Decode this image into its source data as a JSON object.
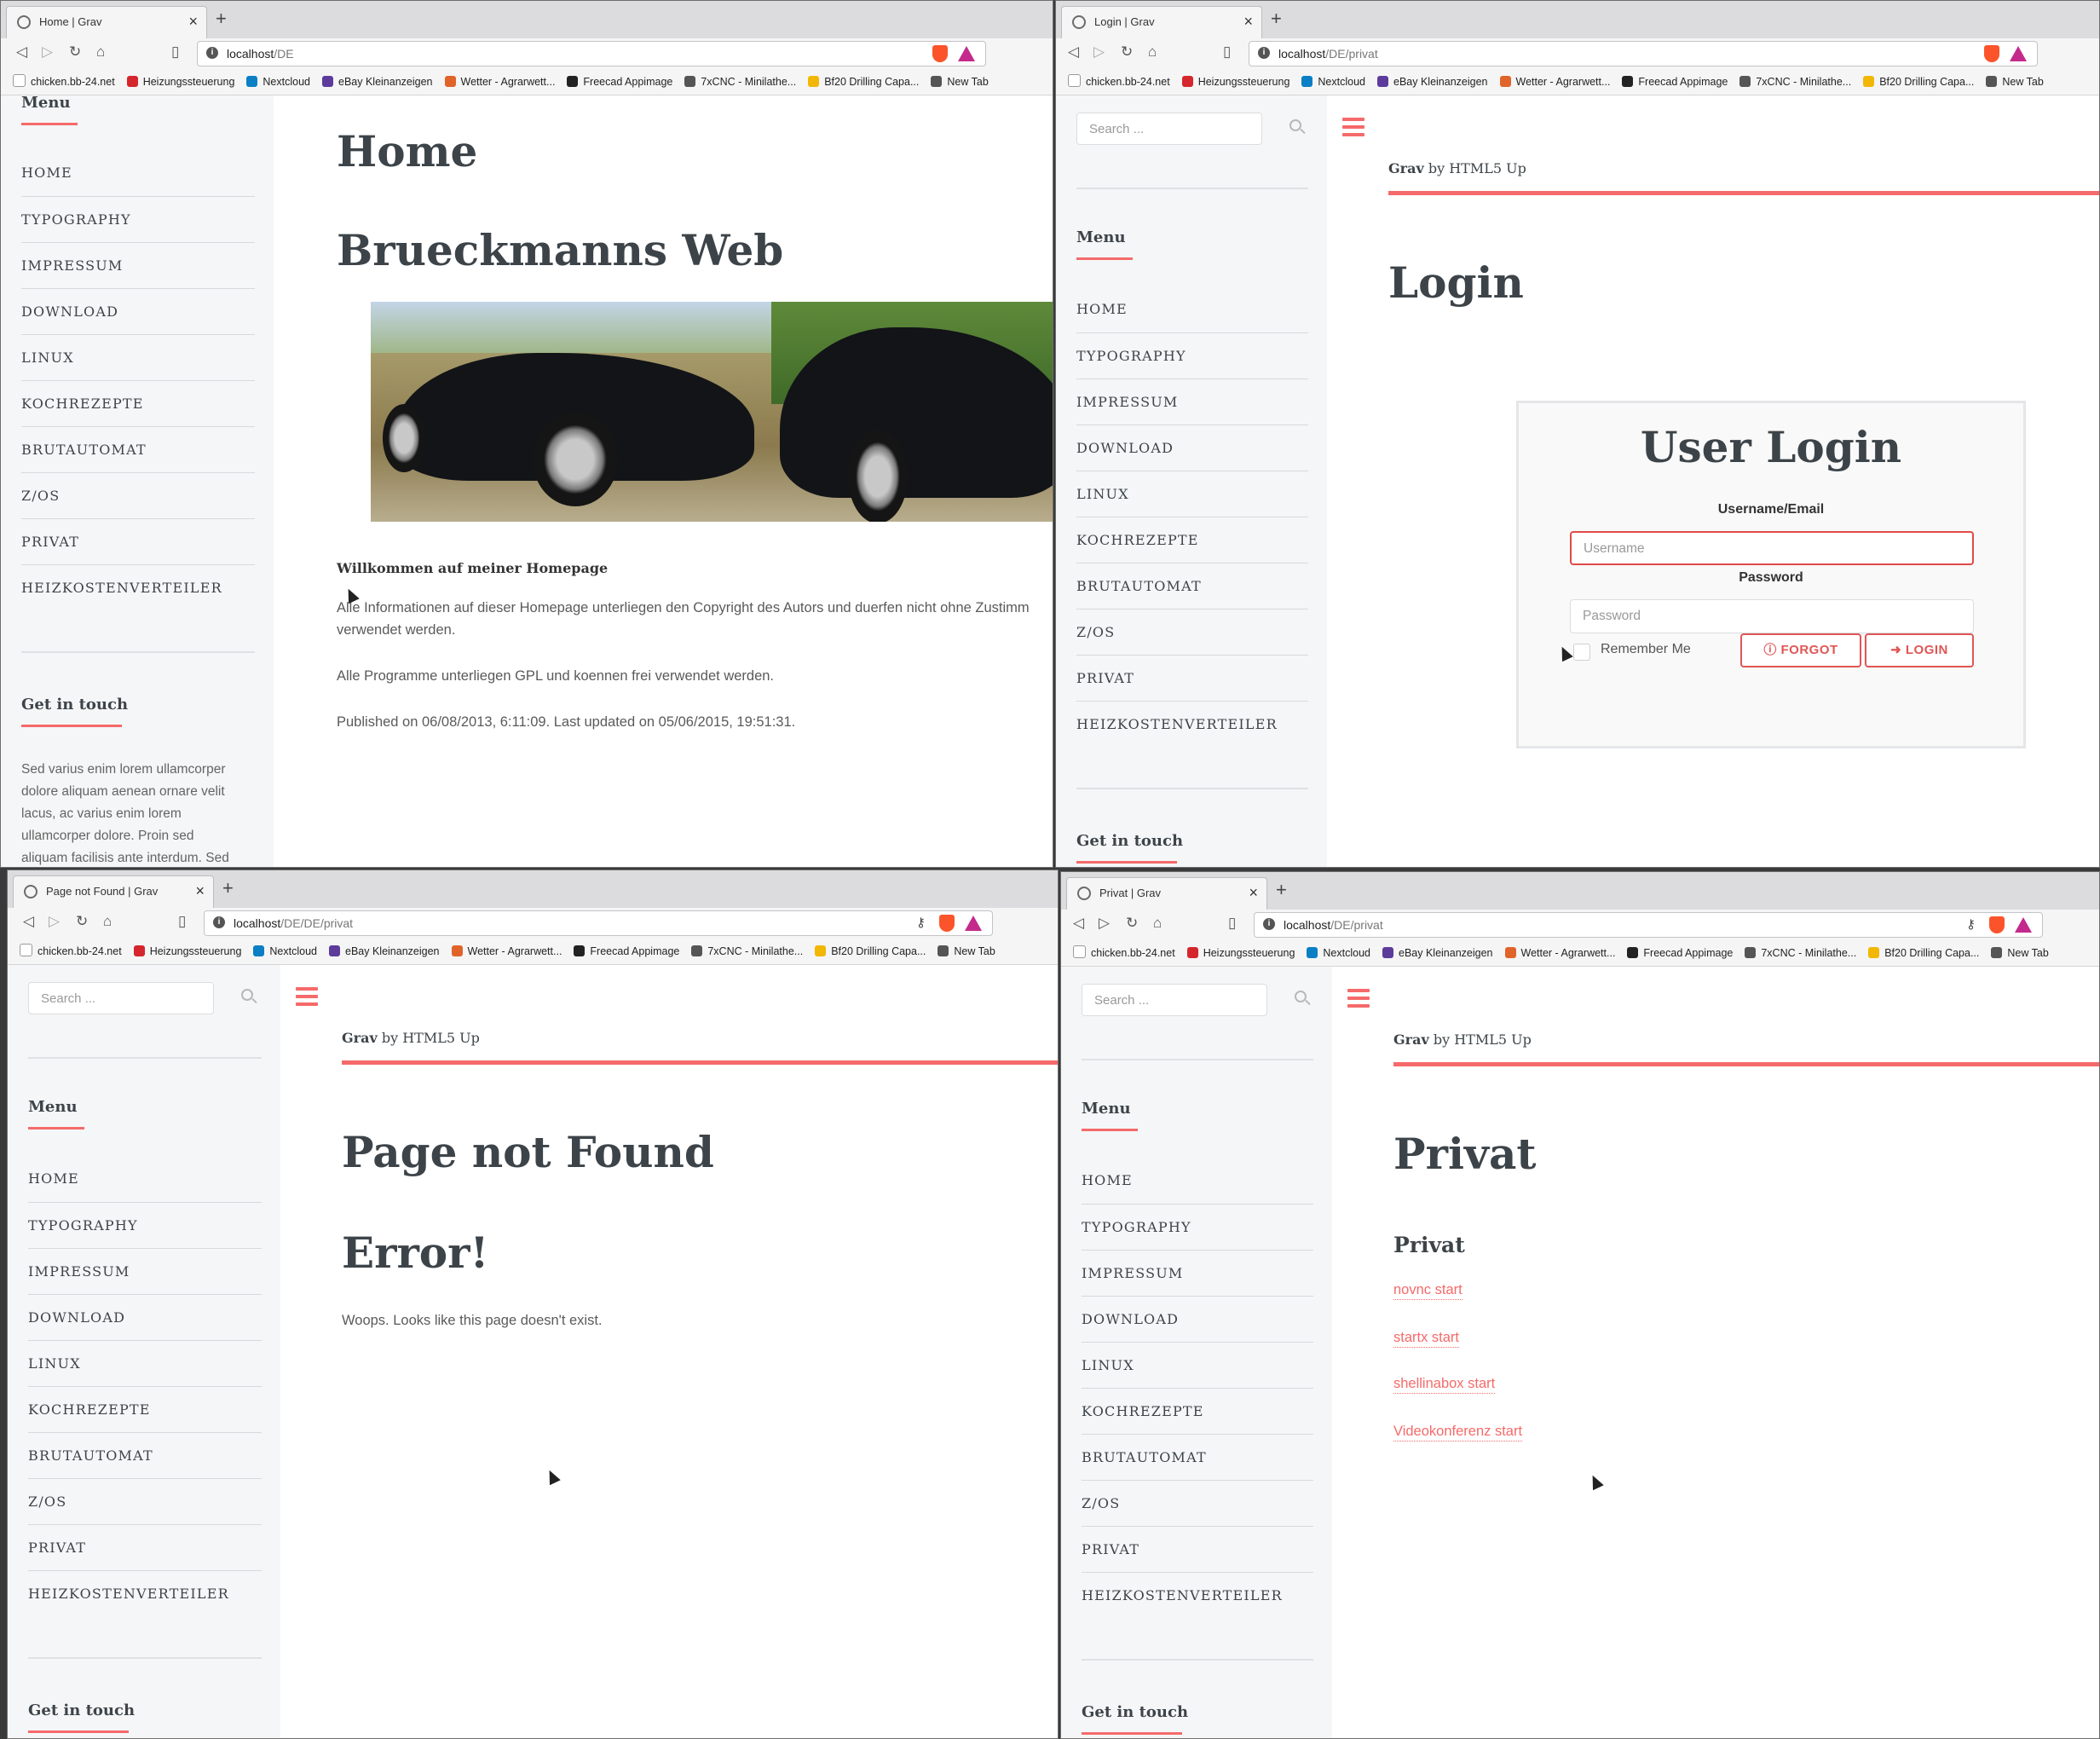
{
  "bookmarks": [
    "chicken.bb-24.net",
    "Heizungssteuerung",
    "Nextcloud",
    "eBay Kleinanzeigen",
    "Wetter - Agrarwett...",
    "Freecad Appimage",
    "7xCNC - Minilathe...",
    "Bf20 Drilling Capa...",
    "New Tab"
  ],
  "bookmark_colors": [
    "#ffffff",
    "#d4262c",
    "#0a7fc4",
    "#5d3b9b",
    "#e0642a",
    "#222222",
    "#555555",
    "#f2b705",
    "#555555"
  ],
  "accent_color": "#f56a6a",
  "menu_heading": "Menu",
  "menu_items": [
    "HOME",
    "TYPOGRAPHY",
    "IMPRESSUM",
    "DOWNLOAD",
    "LINUX",
    "KOCHREZEPTE",
    "BRUTAUTOMAT",
    "Z/OS",
    "PRIVAT",
    "HEIZKOSTENVERTEILER"
  ],
  "get_in_touch": "Get in touch",
  "search_placeholder": "Search ...",
  "brand": {
    "name": "Grav",
    "suffix": "by HTML5 Up"
  },
  "windows": [
    {
      "tab_title": "Home | Grav",
      "url_host": "localhost",
      "url_path": "/DE",
      "page_title": "Home",
      "heading": "Brueckmanns Web",
      "welcome": "Willkommen auf meiner Homepage",
      "para1_line1": "Alle Informationen auf dieser Homepage unterliegen den Copyright des Autors und duerfen nicht ohne Zustimm",
      "para1_line2": "verwendet werden.",
      "para2": "Alle Programme unterliegen GPL und koennen frei verwendet werden.",
      "published": "Published on 06/08/2013, 6:11:09. Last updated on 05/06/2015, 19:51:31.",
      "sidebar_text": [
        "Sed varius enim lorem ullamcorper",
        "dolore aliquam aenean ornare velit",
        "lacus, ac varius enim lorem",
        "ullamcorper dolore. Proin sed",
        "aliquam facilisis ante interdum. Sed"
      ]
    },
    {
      "tab_title": "Login | Grav",
      "url_host": "localhost",
      "url_path": "/DE/privat",
      "page_title": "Login",
      "login_title": "User Login",
      "username_label": "Username/Email",
      "username_placeholder": "Username",
      "password_label": "Password",
      "password_placeholder": "Password",
      "remember_me": "Remember Me",
      "forgot_button": "FORGOT",
      "login_button": "LOGIN"
    },
    {
      "tab_title": "Page not Found | Grav",
      "url_host": "localhost",
      "url_path": "/DE/DE/privat",
      "page_title": "Page not Found",
      "heading": "Error!",
      "message": "Woops. Looks like this page doesn't exist."
    },
    {
      "tab_title": "Privat | Grav",
      "url_host": "localhost",
      "url_path": "/DE/privat",
      "page_title": "Privat",
      "heading": "Privat",
      "links": [
        "novnc start",
        "startx start",
        "shellinabox start",
        "Videokonferenz start"
      ]
    }
  ]
}
